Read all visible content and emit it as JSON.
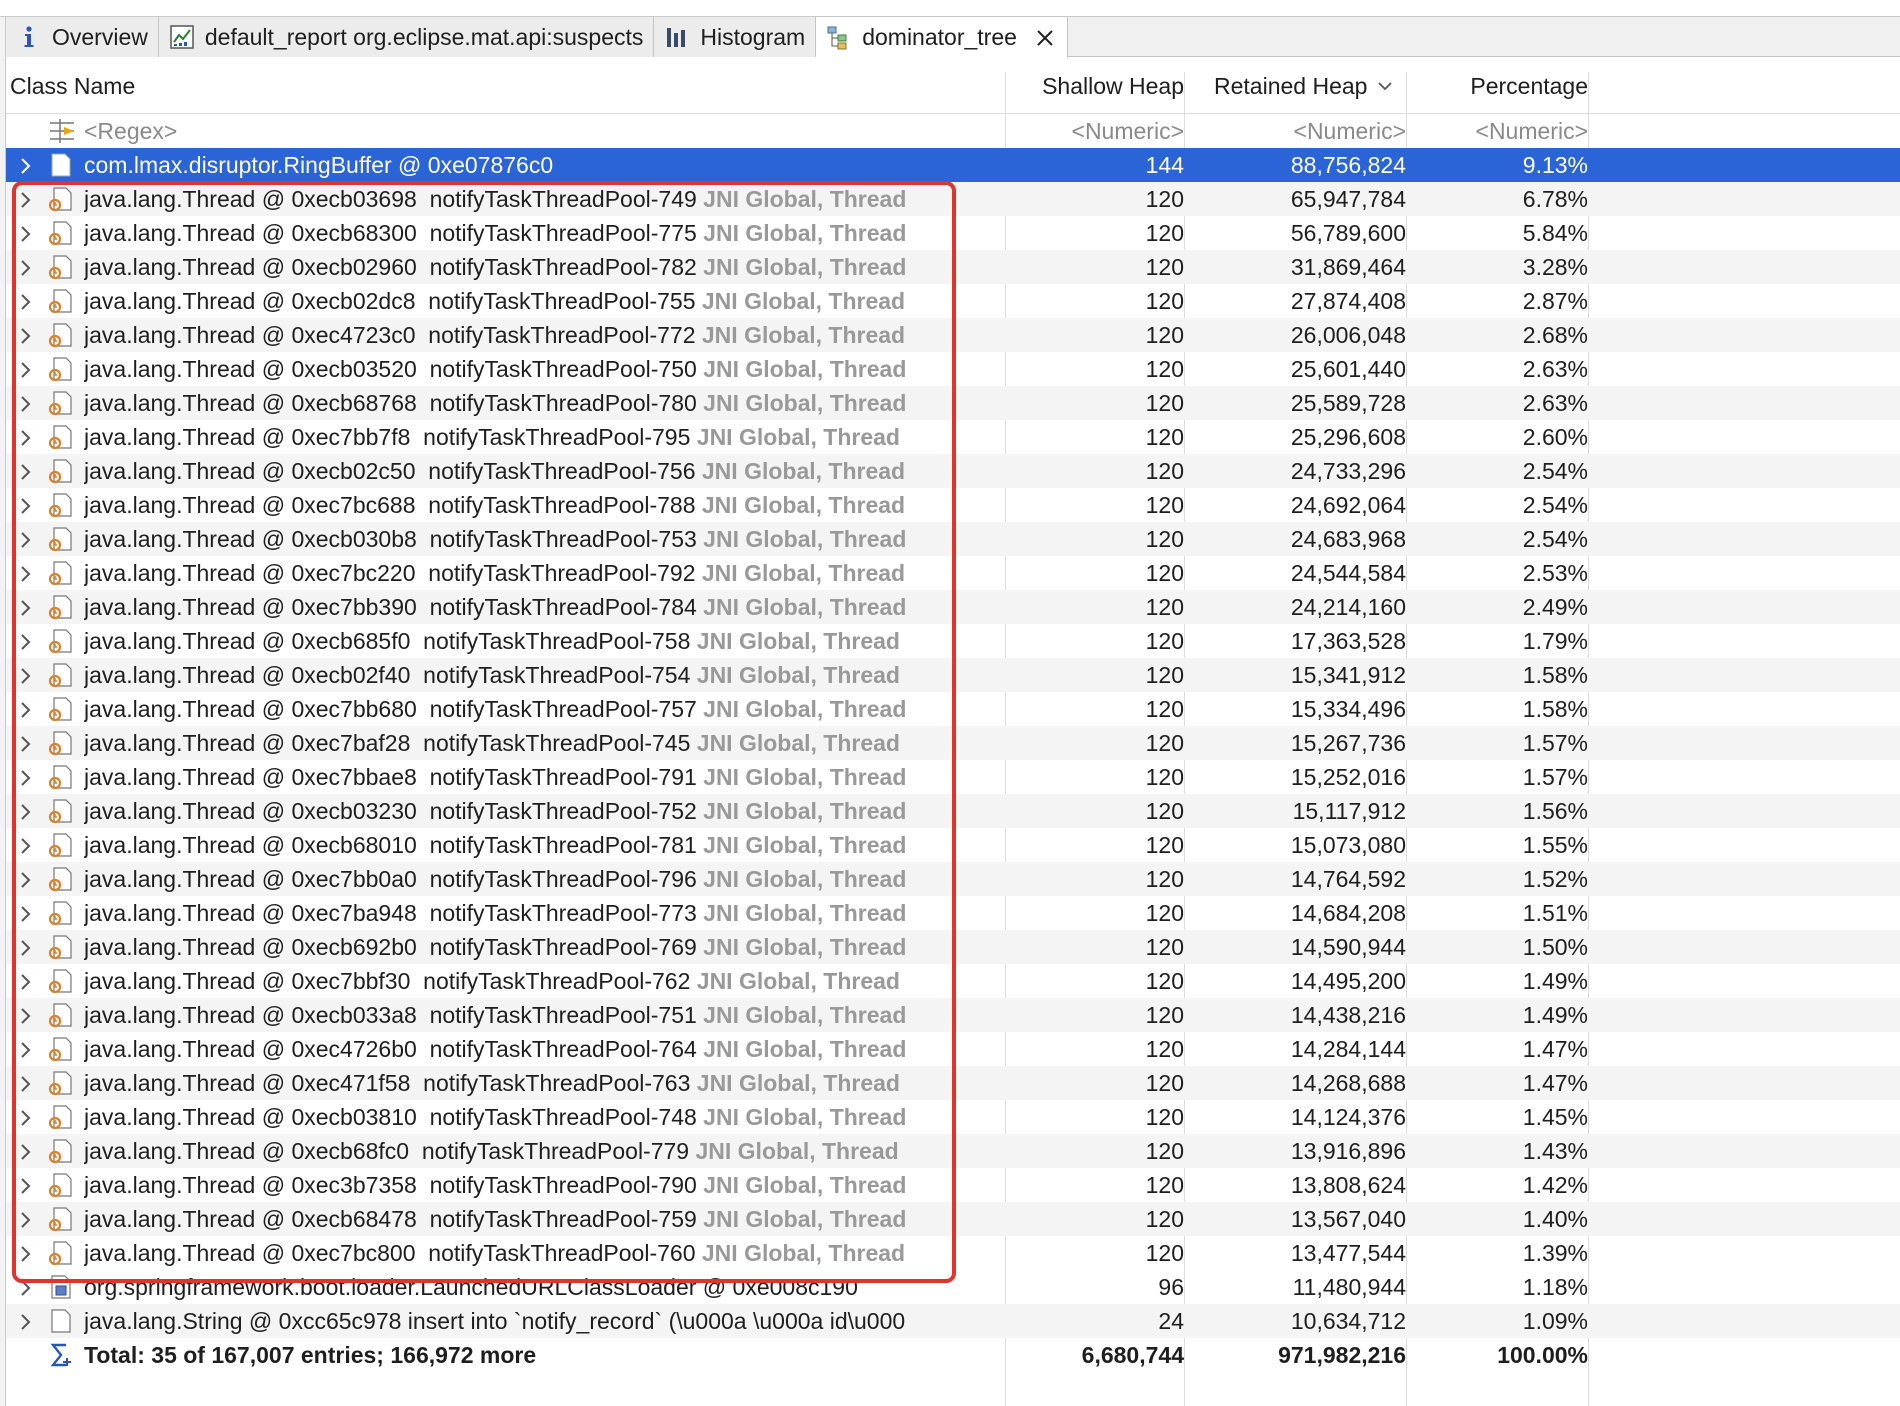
{
  "tabs": [
    {
      "label": "Overview",
      "icon": "info-icon"
    },
    {
      "label": "default_report  org.eclipse.mat.api:suspects",
      "icon": "report-icon"
    },
    {
      "label": "Histogram",
      "icon": "histogram-icon"
    },
    {
      "label": "dominator_tree",
      "icon": "dominator-tree-icon",
      "active": true
    }
  ],
  "columns": {
    "class_name": "Class Name",
    "shallow_heap": "Shallow Heap",
    "retained_heap": "Retained Heap",
    "percentage": "Percentage"
  },
  "filter": {
    "regex": "<Regex>",
    "numeric1": "<Numeric>",
    "numeric2": "<Numeric>",
    "numeric3": "<Numeric>"
  },
  "ringbuffer": {
    "name": "com.lmax.disruptor.RingBuffer @ 0xe07876c0",
    "shallow": "144",
    "retained": "88,756,824",
    "percentage": "9.13%"
  },
  "threads": [
    {
      "name": "java.lang.Thread @ 0xecb03698  notifyTaskThreadPool-749",
      "tag": "JNI Global, Thread",
      "shallow": "120",
      "retained": "65,947,784",
      "percentage": "6.78%"
    },
    {
      "name": "java.lang.Thread @ 0xecb68300  notifyTaskThreadPool-775",
      "tag": "JNI Global, Thread",
      "shallow": "120",
      "retained": "56,789,600",
      "percentage": "5.84%"
    },
    {
      "name": "java.lang.Thread @ 0xecb02960  notifyTaskThreadPool-782",
      "tag": "JNI Global, Thread",
      "shallow": "120",
      "retained": "31,869,464",
      "percentage": "3.28%"
    },
    {
      "name": "java.lang.Thread @ 0xecb02dc8  notifyTaskThreadPool-755",
      "tag": "JNI Global, Thread",
      "shallow": "120",
      "retained": "27,874,408",
      "percentage": "2.87%"
    },
    {
      "name": "java.lang.Thread @ 0xec4723c0  notifyTaskThreadPool-772",
      "tag": "JNI Global, Thread",
      "shallow": "120",
      "retained": "26,006,048",
      "percentage": "2.68%"
    },
    {
      "name": "java.lang.Thread @ 0xecb03520  notifyTaskThreadPool-750",
      "tag": "JNI Global, Thread",
      "shallow": "120",
      "retained": "25,601,440",
      "percentage": "2.63%"
    },
    {
      "name": "java.lang.Thread @ 0xecb68768  notifyTaskThreadPool-780",
      "tag": "JNI Global, Thread",
      "shallow": "120",
      "retained": "25,589,728",
      "percentage": "2.63%"
    },
    {
      "name": "java.lang.Thread @ 0xec7bb7f8  notifyTaskThreadPool-795",
      "tag": "JNI Global, Thread",
      "shallow": "120",
      "retained": "25,296,608",
      "percentage": "2.60%"
    },
    {
      "name": "java.lang.Thread @ 0xecb02c50  notifyTaskThreadPool-756",
      "tag": "JNI Global, Thread",
      "shallow": "120",
      "retained": "24,733,296",
      "percentage": "2.54%"
    },
    {
      "name": "java.lang.Thread @ 0xec7bc688  notifyTaskThreadPool-788",
      "tag": "JNI Global, Thread",
      "shallow": "120",
      "retained": "24,692,064",
      "percentage": "2.54%"
    },
    {
      "name": "java.lang.Thread @ 0xecb030b8  notifyTaskThreadPool-753",
      "tag": "JNI Global, Thread",
      "shallow": "120",
      "retained": "24,683,968",
      "percentage": "2.54%"
    },
    {
      "name": "java.lang.Thread @ 0xec7bc220  notifyTaskThreadPool-792",
      "tag": "JNI Global, Thread",
      "shallow": "120",
      "retained": "24,544,584",
      "percentage": "2.53%"
    },
    {
      "name": "java.lang.Thread @ 0xec7bb390  notifyTaskThreadPool-784",
      "tag": "JNI Global, Thread",
      "shallow": "120",
      "retained": "24,214,160",
      "percentage": "2.49%"
    },
    {
      "name": "java.lang.Thread @ 0xecb685f0  notifyTaskThreadPool-758",
      "tag": "JNI Global, Thread",
      "shallow": "120",
      "retained": "17,363,528",
      "percentage": "1.79%"
    },
    {
      "name": "java.lang.Thread @ 0xecb02f40  notifyTaskThreadPool-754",
      "tag": "JNI Global, Thread",
      "shallow": "120",
      "retained": "15,341,912",
      "percentage": "1.58%"
    },
    {
      "name": "java.lang.Thread @ 0xec7bb680  notifyTaskThreadPool-757",
      "tag": "JNI Global, Thread",
      "shallow": "120",
      "retained": "15,334,496",
      "percentage": "1.58%"
    },
    {
      "name": "java.lang.Thread @ 0xec7baf28  notifyTaskThreadPool-745",
      "tag": "JNI Global, Thread",
      "shallow": "120",
      "retained": "15,267,736",
      "percentage": "1.57%"
    },
    {
      "name": "java.lang.Thread @ 0xec7bbae8  notifyTaskThreadPool-791",
      "tag": "JNI Global, Thread",
      "shallow": "120",
      "retained": "15,252,016",
      "percentage": "1.57%"
    },
    {
      "name": "java.lang.Thread @ 0xecb03230  notifyTaskThreadPool-752",
      "tag": "JNI Global, Thread",
      "shallow": "120",
      "retained": "15,117,912",
      "percentage": "1.56%"
    },
    {
      "name": "java.lang.Thread @ 0xecb68010  notifyTaskThreadPool-781",
      "tag": "JNI Global, Thread",
      "shallow": "120",
      "retained": "15,073,080",
      "percentage": "1.55%"
    },
    {
      "name": "java.lang.Thread @ 0xec7bb0a0  notifyTaskThreadPool-796",
      "tag": "JNI Global, Thread",
      "shallow": "120",
      "retained": "14,764,592",
      "percentage": "1.52%"
    },
    {
      "name": "java.lang.Thread @ 0xec7ba948  notifyTaskThreadPool-773",
      "tag": "JNI Global, Thread",
      "shallow": "120",
      "retained": "14,684,208",
      "percentage": "1.51%"
    },
    {
      "name": "java.lang.Thread @ 0xecb692b0  notifyTaskThreadPool-769",
      "tag": "JNI Global, Thread",
      "shallow": "120",
      "retained": "14,590,944",
      "percentage": "1.50%"
    },
    {
      "name": "java.lang.Thread @ 0xec7bbf30  notifyTaskThreadPool-762",
      "tag": "JNI Global, Thread",
      "shallow": "120",
      "retained": "14,495,200",
      "percentage": "1.49%"
    },
    {
      "name": "java.lang.Thread @ 0xecb033a8  notifyTaskThreadPool-751",
      "tag": "JNI Global, Thread",
      "shallow": "120",
      "retained": "14,438,216",
      "percentage": "1.49%"
    },
    {
      "name": "java.lang.Thread @ 0xec4726b0  notifyTaskThreadPool-764",
      "tag": "JNI Global, Thread",
      "shallow": "120",
      "retained": "14,284,144",
      "percentage": "1.47%"
    },
    {
      "name": "java.lang.Thread @ 0xec471f58  notifyTaskThreadPool-763",
      "tag": "JNI Global, Thread",
      "shallow": "120",
      "retained": "14,268,688",
      "percentage": "1.47%"
    },
    {
      "name": "java.lang.Thread @ 0xecb03810  notifyTaskThreadPool-748",
      "tag": "JNI Global, Thread",
      "shallow": "120",
      "retained": "14,124,376",
      "percentage": "1.45%"
    },
    {
      "name": "java.lang.Thread @ 0xecb68fc0  notifyTaskThreadPool-779",
      "tag": "JNI Global, Thread",
      "shallow": "120",
      "retained": "13,916,896",
      "percentage": "1.43%"
    },
    {
      "name": "java.lang.Thread @ 0xec3b7358  notifyTaskThreadPool-790",
      "tag": "JNI Global, Thread",
      "shallow": "120",
      "retained": "13,808,624",
      "percentage": "1.42%"
    },
    {
      "name": "java.lang.Thread @ 0xecb68478  notifyTaskThreadPool-759",
      "tag": "JNI Global, Thread",
      "shallow": "120",
      "retained": "13,567,040",
      "percentage": "1.40%"
    },
    {
      "name": "java.lang.Thread @ 0xec7bc800  notifyTaskThreadPool-760",
      "tag": "JNI Global, Thread",
      "shallow": "120",
      "retained": "13,477,544",
      "percentage": "1.39%"
    }
  ],
  "classloader": {
    "name": "org.springframework.boot.loader.LaunchedURLClassLoader @ 0xe008c190",
    "shallow": "96",
    "retained": "11,480,944",
    "percentage": "1.18%"
  },
  "string_row": {
    "name": "java.lang.String @ 0xcc65c978  insert into `notify_record` (\\u000a      \\u000a      id\\u000",
    "shallow": "24",
    "retained": "10,634,712",
    "percentage": "1.09%"
  },
  "total": {
    "label": "Total: 35 of 167,007 entries; 166,972 more",
    "shallow": "6,680,744",
    "retained": "971,982,216",
    "percentage": "100.00%"
  },
  "colors": {
    "selection": "#2a64d6",
    "highlight_border": "#e0342e",
    "thread_icon": "#d9822b",
    "muted_text": "#8a8a8a"
  }
}
